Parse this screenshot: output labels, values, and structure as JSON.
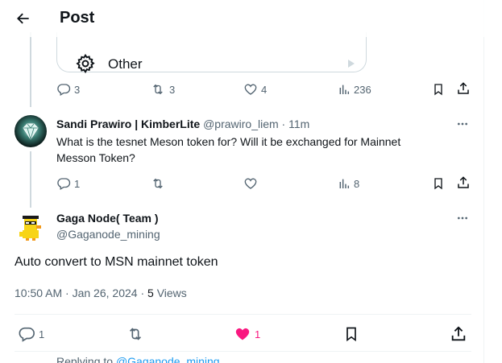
{
  "header": {
    "title": "Post"
  },
  "poll_card": {
    "option_label": "Other"
  },
  "prev_tweet_actions": {
    "replies": "3",
    "reposts": "3",
    "likes": "4",
    "views": "236"
  },
  "reply_tweet": {
    "display_name": "Sandi Prawiro | KimberLite",
    "handle": "@prawiro_liem",
    "time": "· 11m",
    "text_line1": "What is the tesnet Meson token for? Will it be exchanged for Mainnet",
    "text_line2": "Messon Token?",
    "replies": "1",
    "views": "8"
  },
  "main_tweet": {
    "display_name": "Gaga Node( Team )",
    "handle": "@Gaganode_mining",
    "text": "Auto convert to MSN mainnet token",
    "timestamp": "10:50 AM · Jan 26, 2024 ·",
    "views_count": "5",
    "views_label": "Views",
    "replies": "1",
    "likes": "1"
  },
  "replying_to": {
    "prefix": "Replying to",
    "handle": "@Gaganode_mining"
  },
  "colors": {
    "accent": "#1d9bf0",
    "like": "#f91880",
    "muted": "#536471"
  }
}
